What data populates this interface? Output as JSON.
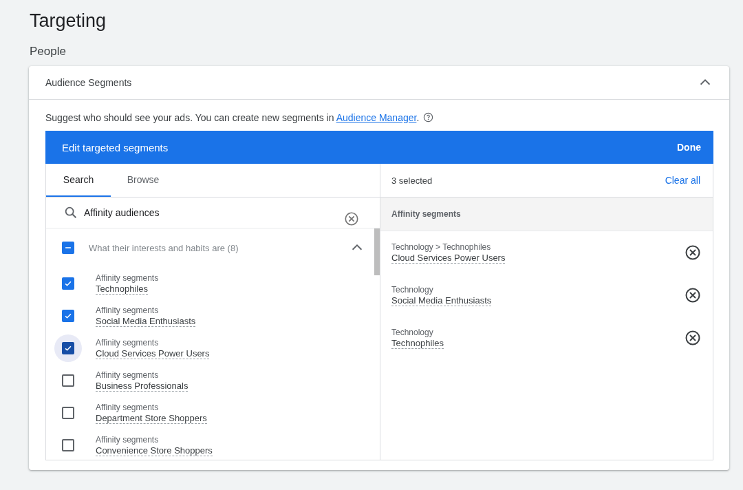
{
  "page_title": "Targeting",
  "section_title": "People",
  "card": {
    "title": "Audience Segments",
    "expanded": true,
    "description": "Suggest who should see your ads.  You can create new segments in ",
    "link": "Audience Manager",
    "description_end": ".",
    "editor": {
      "title": "Edit targeted segments",
      "done": "Done",
      "tabs": [
        {
          "label": "Search",
          "selected": true
        },
        {
          "label": "Browse",
          "selected": false
        }
      ],
      "search": {
        "value": "Affinity audiences"
      },
      "group": {
        "label": "What their interests and habits are (8)",
        "expanded": true,
        "indeterminate": true
      },
      "items": [
        {
          "category": "Affinity segments",
          "name": "Technophiles",
          "checked": true,
          "focused": false
        },
        {
          "category": "Affinity segments",
          "name": "Social Media Enthusiasts",
          "checked": true,
          "focused": false
        },
        {
          "category": "Affinity segments",
          "name": "Cloud Services Power Users",
          "checked": true,
          "focused": true
        },
        {
          "category": "Affinity segments",
          "name": "Business Professionals",
          "checked": false,
          "focused": false
        },
        {
          "category": "Affinity segments",
          "name": "Department Store Shoppers",
          "checked": false,
          "focused": false
        },
        {
          "category": "Affinity segments",
          "name": "Convenience Store Shoppers",
          "checked": false,
          "focused": false
        }
      ],
      "selected_count": "3 selected",
      "clear_all": "Clear all",
      "selected_group": "Affinity segments",
      "selected": [
        {
          "path": "Technology > Technophiles",
          "name": "Cloud Services Power Users"
        },
        {
          "path": "Technology",
          "name": "Social Media Enthusiasts"
        },
        {
          "path": "Technology",
          "name": "Technophiles"
        }
      ]
    }
  }
}
